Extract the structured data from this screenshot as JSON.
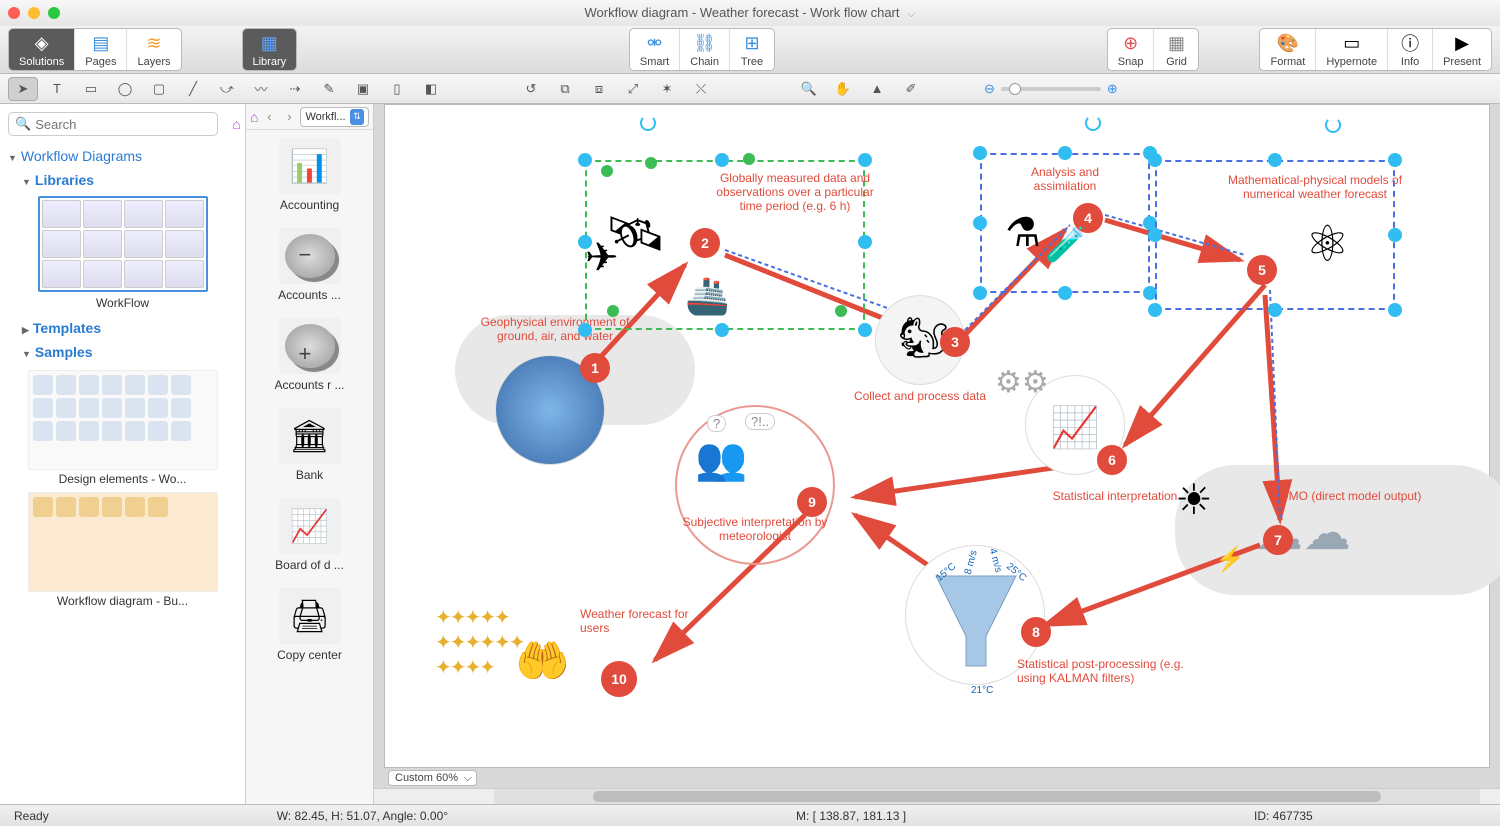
{
  "window": {
    "title": "Workflow diagram - Weather forecast - Work flow chart"
  },
  "toolbar": {
    "solutions": "Solutions",
    "pages": "Pages",
    "layers": "Layers",
    "library": "Library",
    "smart": "Smart",
    "chain": "Chain",
    "tree": "Tree",
    "snap": "Snap",
    "grid": "Grid",
    "format": "Format",
    "hypernote": "Hypernote",
    "info": "Info",
    "present": "Present"
  },
  "search": {
    "placeholder": "Search"
  },
  "tree": {
    "root": "Workflow Diagrams",
    "libraries": "Libraries",
    "workflow": "WorkFlow",
    "templates": "Templates",
    "samples": "Samples",
    "sample1": "Design elements - Wo...",
    "sample2": "Workflow diagram - Bu..."
  },
  "libdrop": {
    "label": "Workfl..."
  },
  "libitems": [
    {
      "label": "Accounting"
    },
    {
      "label": "Accounts  ..."
    },
    {
      "label": "Accounts r ..."
    },
    {
      "label": "Bank"
    },
    {
      "label": "Board of d ..."
    },
    {
      "label": "Copy center"
    }
  ],
  "canvas": {
    "zoom_label": "Custom 60%",
    "nodes": {
      "n1": {
        "label": "Geophysical environment of ground, air, and water",
        "badge": "1"
      },
      "n2": {
        "label": "Globally measured data and observations over a particular time period (e.g. 6 h)",
        "badge": "2"
      },
      "n3": {
        "label": "Collect and process data",
        "badge": "3"
      },
      "n4": {
        "label": "Analysis and assimilation",
        "badge": "4"
      },
      "n5": {
        "label": "Mathematical-physical models of numerical weather forecast",
        "badge": "5"
      },
      "n6": {
        "label": "Statistical interpretation",
        "badge": "6"
      },
      "n7": {
        "label": "DMO (direct model output)",
        "badge": "7"
      },
      "n8": {
        "label": "Statistical post-processing (e.g. using KALMAN filters)",
        "badge": "8"
      },
      "n9": {
        "label": "Subjective interpretation by meteorologist",
        "badge": "9"
      },
      "n10": {
        "label": "Weather forecast for users",
        "badge": "10"
      }
    },
    "funnel": {
      "t1": "15°C",
      "t2": "8 m/s",
      "t3": "4 m/s",
      "t4": "25°C",
      "t5": "21°C"
    }
  },
  "status": {
    "ready": "Ready",
    "dims": "W: 82.45,  H: 51.07,  Angle: 0.00°",
    "mouse": "M: [ 138.87, 181.13 ]",
    "id": "ID: 467735"
  }
}
